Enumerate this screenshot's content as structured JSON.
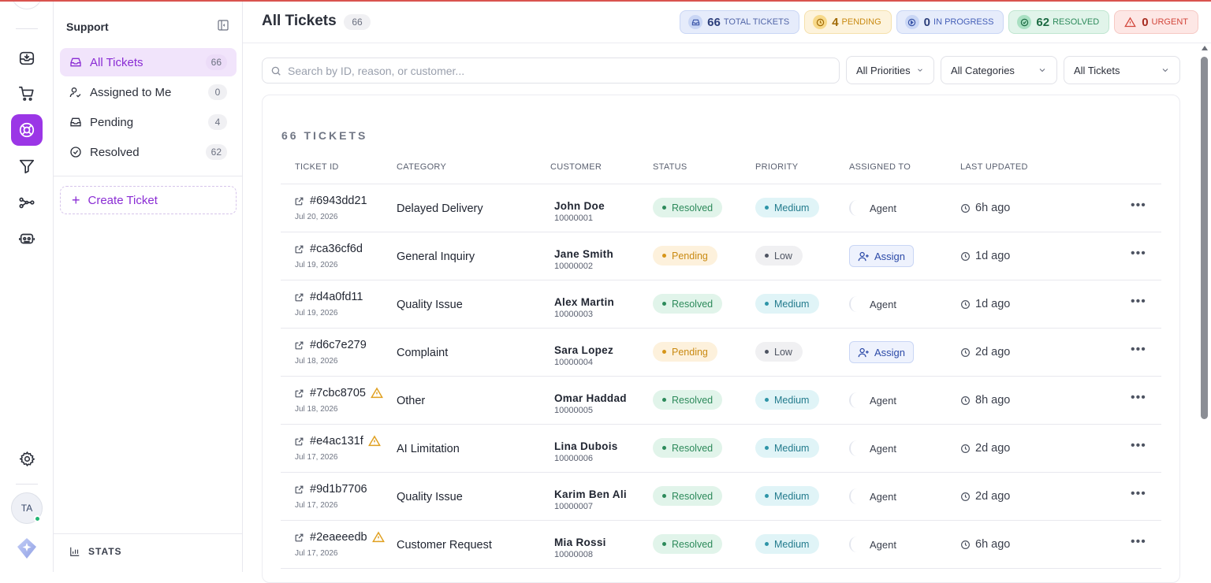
{
  "colors": {
    "accent": "#9b36e6",
    "resolved": "#2d8a5b",
    "pending": "#c98a12",
    "urgent": "#d2463b",
    "progress": "#4660b8"
  },
  "rail": {
    "icons": [
      "inbox-icon",
      "cart-icon",
      "lifebuoy-icon",
      "filter-icon",
      "share-nodes-icon",
      "robot-icon",
      "gear-icon"
    ],
    "avatar_initials": "TA"
  },
  "sidebar": {
    "title": "Support",
    "items": [
      {
        "label": "All Tickets",
        "count": "66",
        "icon": "inbox-icon"
      },
      {
        "label": "Assigned to Me",
        "count": "0",
        "icon": "user-check-icon"
      },
      {
        "label": "Pending",
        "count": "4",
        "icon": "inbox-icon"
      },
      {
        "label": "Resolved",
        "count": "62",
        "icon": "check-circle-icon"
      }
    ],
    "create_label": "Create Ticket",
    "stats_label": "STATS"
  },
  "header": {
    "title": "All Tickets",
    "count": "66",
    "chips": {
      "total": {
        "value": "66",
        "label": "TOTAL TICKETS"
      },
      "pending": {
        "value": "4",
        "label": "PENDING"
      },
      "progress": {
        "value": "0",
        "label": "IN PROGRESS"
      },
      "resolved": {
        "value": "62",
        "label": "RESOLVED"
      },
      "urgent": {
        "value": "0",
        "label": "URGENT"
      }
    }
  },
  "filters": {
    "search_placeholder": "Search by ID, reason, or customer...",
    "priority": "All Priorities",
    "category": "All Categories",
    "tickets": "All Tickets"
  },
  "table": {
    "title": "66 TICKETS",
    "columns": [
      "TICKET ID",
      "CATEGORY",
      "CUSTOMER",
      "STATUS",
      "PRIORITY",
      "ASSIGNED TO",
      "LAST UPDATED"
    ],
    "rows": [
      {
        "id": "#6943dd21",
        "date": "Jul 20, 2026",
        "warn": false,
        "category": "Delayed Delivery",
        "customer": "John Doe",
        "customer_id": "10000001",
        "status": "Resolved",
        "priority": "Medium",
        "assigned": "Agent",
        "updated": "6h ago"
      },
      {
        "id": "#ca36cf6d",
        "date": "Jul 19, 2026",
        "warn": false,
        "category": "General Inquiry",
        "customer": "Jane Smith",
        "customer_id": "10000002",
        "status": "Pending",
        "priority": "Low",
        "assigned": "Assign",
        "updated": "1d ago"
      },
      {
        "id": "#d4a0fd11",
        "date": "Jul 19, 2026",
        "warn": false,
        "category": "Quality Issue",
        "customer": "Alex Martin",
        "customer_id": "10000003",
        "status": "Resolved",
        "priority": "Medium",
        "assigned": "Agent",
        "updated": "1d ago"
      },
      {
        "id": "#d6c7e279",
        "date": "Jul 18, 2026",
        "warn": false,
        "category": "Complaint",
        "customer": "Sara Lopez",
        "customer_id": "10000004",
        "status": "Pending",
        "priority": "Low",
        "assigned": "Assign",
        "updated": "2d ago"
      },
      {
        "id": "#7cbc8705",
        "date": "Jul 18, 2026",
        "warn": true,
        "category": "Other",
        "customer": "Omar Haddad",
        "customer_id": "10000005",
        "status": "Resolved",
        "priority": "Medium",
        "assigned": "Agent",
        "updated": "8h ago"
      },
      {
        "id": "#e4ac131f",
        "date": "Jul 17, 2026",
        "warn": true,
        "category": "AI Limitation",
        "customer": "Lina Dubois",
        "customer_id": "10000006",
        "status": "Resolved",
        "priority": "Medium",
        "assigned": "Agent",
        "updated": "2d ago"
      },
      {
        "id": "#9d1b7706",
        "date": "Jul 17, 2026",
        "warn": false,
        "category": "Quality Issue",
        "customer": "Karim Ben Ali",
        "customer_id": "10000007",
        "status": "Resolved",
        "priority": "Medium",
        "assigned": "Agent",
        "updated": "2d ago"
      },
      {
        "id": "#2eaeeedb",
        "date": "Jul 17, 2026",
        "warn": true,
        "category": "Customer Request",
        "customer": "Mia Rossi",
        "customer_id": "10000008",
        "status": "Resolved",
        "priority": "Medium",
        "assigned": "Agent",
        "updated": "6h ago"
      }
    ]
  }
}
